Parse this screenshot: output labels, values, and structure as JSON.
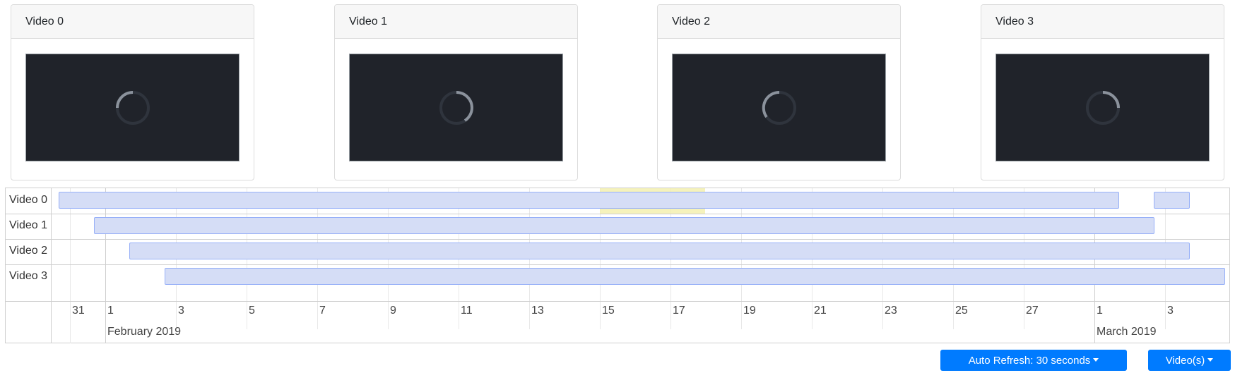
{
  "videos": [
    {
      "title": "Video 0"
    },
    {
      "title": "Video 1"
    },
    {
      "title": "Video 2"
    },
    {
      "title": "Video 3"
    }
  ],
  "timeline": {
    "rows": [
      "Video 0",
      "Video 1",
      "Video 2",
      "Video 3"
    ],
    "minor_labels": [
      "31",
      "1",
      "3",
      "5",
      "7",
      "9",
      "11",
      "13",
      "15",
      "17",
      "19",
      "21",
      "23",
      "25",
      "27",
      "1",
      "3"
    ],
    "major_labels": [
      "February 2019",
      "March 2019"
    ]
  },
  "controls": {
    "auto_refresh_label": "Auto Refresh: 30 seconds",
    "videos_label": "Video(s)"
  },
  "colors": {
    "accent": "#007bff",
    "player_bg": "#20232a",
    "range_fill": "#d5ddf6",
    "range_border": "#97b0f8",
    "highlight": "#f3f0b0"
  },
  "icons": {
    "loading": "spinner-icon",
    "dropdown": "caret-down-icon"
  }
}
